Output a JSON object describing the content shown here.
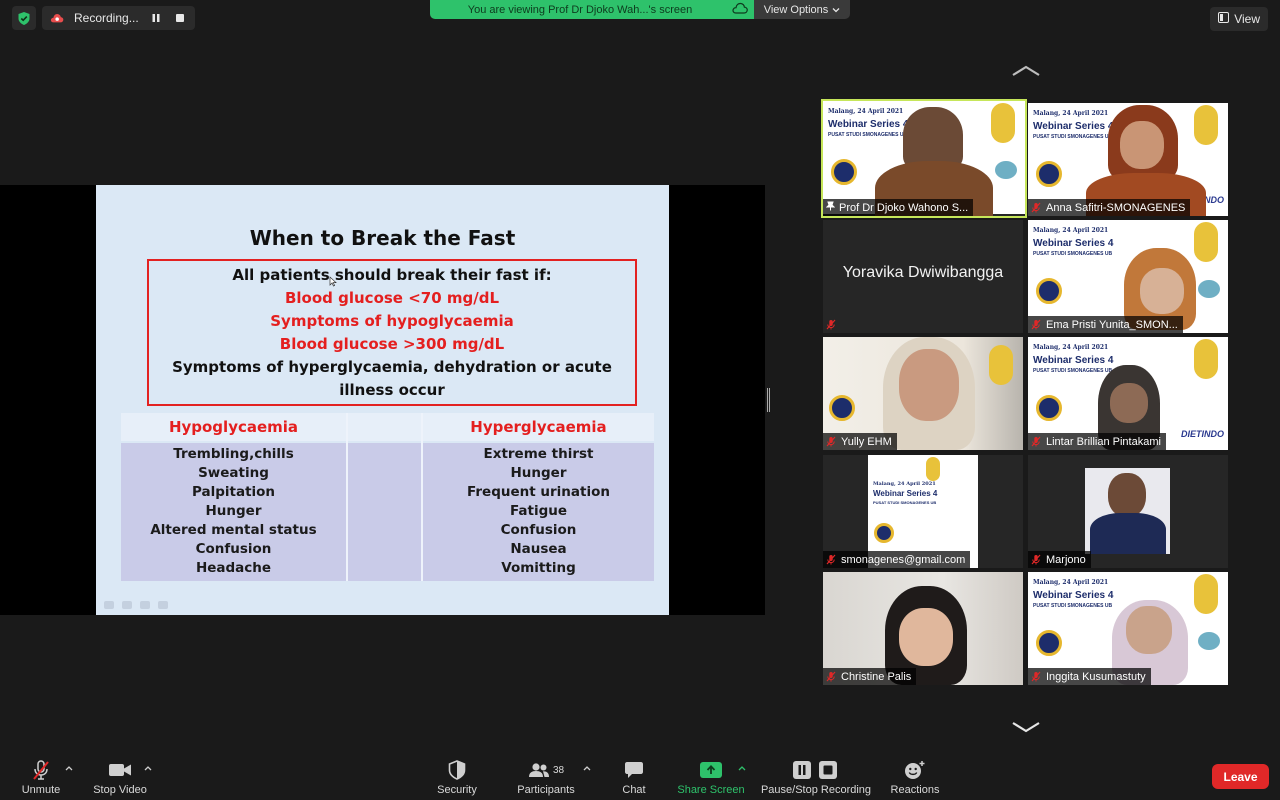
{
  "top": {
    "recording_label": "Recording...",
    "banner_text": "You are viewing Prof Dr Djoko Wah...'s screen",
    "view_options_label": "View Options",
    "view_label": "View"
  },
  "slide": {
    "title": "When to Break the Fast",
    "criteria_intro": "All patients should break their fast if:",
    "criteria_red": [
      "Blood glucose <70 mg/dL",
      "Symptoms of hypoglycaemia",
      "Blood glucose >300 mg/dL"
    ],
    "criteria_last": "Symptoms of hyperglycaemia, dehydration or acute illness occur",
    "hypo_header": "Hypoglycaemia",
    "hyper_header": "Hyperglycaemia",
    "hypo_items": [
      "Trembling,chills",
      "Sweating",
      "Palpitation",
      "Hunger",
      "Altered mental status",
      "Confusion",
      "Headache"
    ],
    "hyper_items": [
      "Extreme thirst",
      "Hunger",
      "Frequent urination",
      "Fatigue",
      "Confusion",
      "Nausea",
      "Vomitting"
    ]
  },
  "banner": {
    "date": "Malang, 24 April 2021",
    "title": "Webinar Series 4",
    "subtitle": "PUSAT STUDI SMONAGENES UB",
    "dietindo": "DIETINDO"
  },
  "participants": [
    {
      "name": "Prof Dr Djoko Wahono S...",
      "video": true
    },
    {
      "name": "Anna Safitri-SMONAGENES",
      "video": true
    },
    {
      "name": "Yoravika Dwiwibangga",
      "video": false
    },
    {
      "name": "Ema Pristi Yunita_SMON...",
      "video": true
    },
    {
      "name": "Yully EHM",
      "video": true
    },
    {
      "name": "Lintar Brillian Pintakami",
      "video": true
    },
    {
      "name": "smonagenes@gmail.com",
      "video": true
    },
    {
      "name": "Marjono",
      "video": true
    },
    {
      "name": "Christine Palis",
      "video": true
    },
    {
      "name": "Inggita Kusumastuty",
      "video": true
    }
  ],
  "toolbar": {
    "unmute": "Unmute",
    "stop_video": "Stop Video",
    "security": "Security",
    "participants": "Participants",
    "participants_count": "38",
    "chat": "Chat",
    "share_screen": "Share Screen",
    "pause_stop_recording": "Pause/Stop Recording",
    "reactions": "Reactions",
    "leave": "Leave"
  },
  "colors": {
    "share_green": "#2ec26b",
    "leave_red": "#e02828",
    "active_speaker": "#c6e65a",
    "slide_red": "#e41f1f"
  }
}
